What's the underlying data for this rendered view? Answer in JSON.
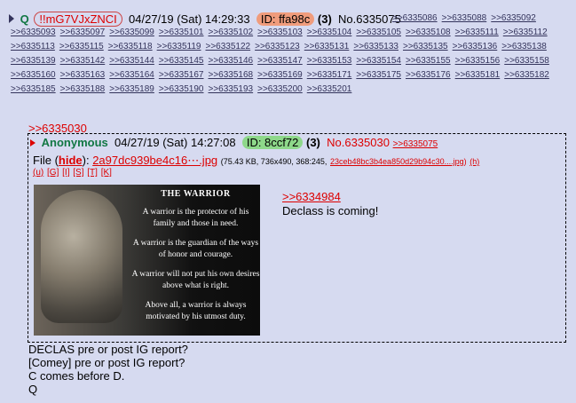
{
  "post": {
    "name": "Q",
    "tripcode": "!!mG7VJxZNCI",
    "datetime": "04/27/19 (Sat) 14:29:33",
    "id_label": "ID: ffa98c",
    "reply_count": "(3)",
    "post_no": "No.6335075",
    "backlinks": [
      ">>6335086",
      ">>6335088",
      ">>6335092",
      ">>6335093",
      ">>6335097",
      ">>6335099",
      ">>6335101",
      ">>6335102",
      ">>6335103",
      ">>6335104",
      ">>6335105",
      ">>6335108",
      ">>6335111",
      ">>6335112",
      ">>6335113",
      ">>6335115",
      ">>6335118",
      ">>6335119",
      ">>6335122",
      ">>6335123",
      ">>6335131",
      ">>6335133",
      ">>6335135",
      ">>6335136",
      ">>6335138",
      ">>6335139",
      ">>6335142",
      ">>6335144",
      ">>6335145",
      ">>6335146",
      ">>6335147",
      ">>6335153",
      ">>6335154",
      ">>6335155",
      ">>6335156",
      ">>6335158",
      ">>6335160",
      ">>6335163",
      ">>6335164",
      ">>6335167",
      ">>6335168",
      ">>6335169",
      ">>6335171",
      ">>6335175",
      ">>6335176",
      ">>6335181",
      ">>6335182",
      ">>6335185",
      ">>6335188",
      ">>6335189",
      ">>6335190",
      ">>6335193",
      ">>6335200",
      ">>6335201"
    ],
    "quote_link": ">>6335030",
    "message_lines": [
      "DECLAS pre or post IG report?",
      "[Comey]  pre or post IG report?",
      "C comes before D.",
      "Q"
    ]
  },
  "inline": {
    "name": "Anonymous",
    "datetime": "04/27/19 (Sat) 14:27:08",
    "id_label": "ID: 8ccf72",
    "reply_count": "(3)",
    "post_no": "No.6335030",
    "backlink": ">>6335075",
    "file_label": "File",
    "hide_label": "hide",
    "file_name": "2a97dc939be4c16⋯.jpg",
    "file_meta": "(75.43 KB, 736x490, 368:245,",
    "file_hash": "23ceb48bc3b4ea850d29b94c30....jpg",
    "h_label": "(h)",
    "tools": [
      "(u)",
      "[G]",
      "[I]",
      "[S]",
      "[T]",
      "[K]"
    ],
    "body_quote": ">>6334984",
    "body_text": "Declass is coming!",
    "image": {
      "title": "THE WARRIOR",
      "lines": [
        "A warrior is the protector of his family and those in need.",
        "A warrior is the guardian of the ways of honor and courage.",
        "A warrior will not put his own desires above what is right.",
        "Above all, a warrior is always motivated by his utmost duty."
      ]
    }
  }
}
